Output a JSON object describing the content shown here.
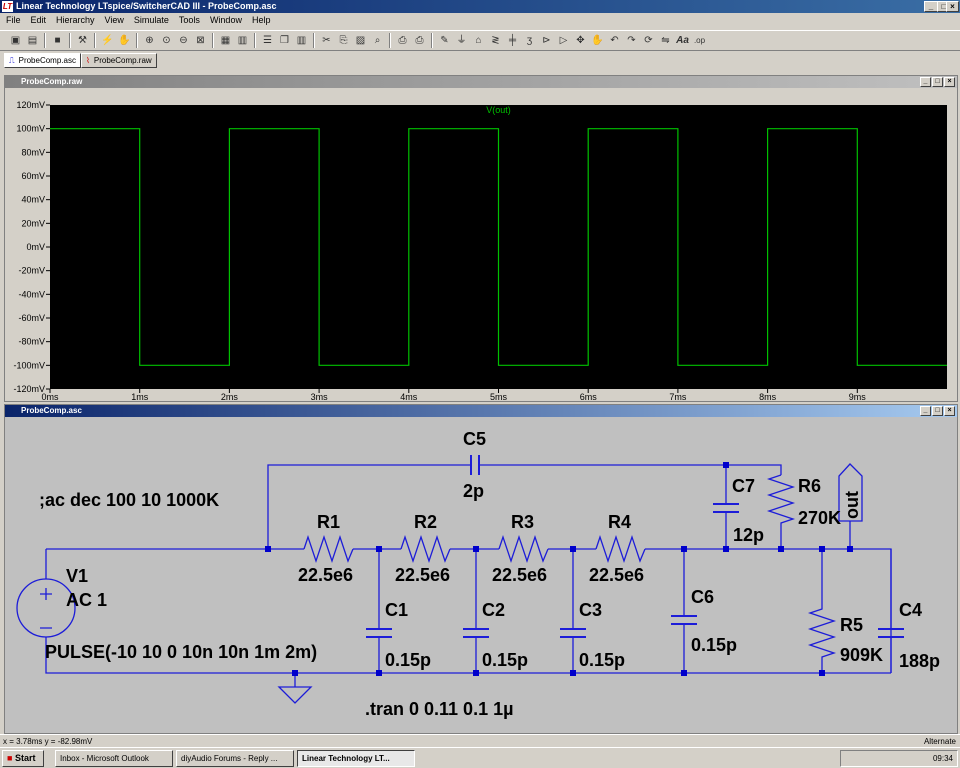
{
  "app": {
    "title": "Linear Technology LTspice/SwitcherCAD III - ProbeComp.asc",
    "window_buttons": [
      "_",
      "□",
      "×"
    ]
  },
  "menu": [
    "File",
    "Edit",
    "Hierarchy",
    "View",
    "Simulate",
    "Tools",
    "Window",
    "Help"
  ],
  "toolbar": {
    "icons": [
      "new-schematic-icon",
      "open-icon",
      "save-icon",
      "control-panel-icon",
      "run-icon",
      "halt-icon",
      "zoom-in-icon",
      "pan-icon",
      "zoom-out-icon",
      "zoom-fit-icon",
      "autorange-icon",
      "fft-icon",
      "tile-horizontal-icon",
      "cascade-icon",
      "tile-vertical-icon",
      "cut-icon",
      "copy-icon",
      "paste-icon",
      "find-icon",
      "print-setup-icon",
      "print-icon",
      "wire-icon",
      "ground-icon",
      "label-net-icon",
      "resistor-icon",
      "capacitor-icon",
      "inductor-icon",
      "diode-icon",
      "component-icon",
      "move-icon",
      "drag-icon",
      "undo-icon",
      "redo-icon",
      "rotate-icon",
      "mirror-icon",
      "text-icon",
      "spice-directive-icon"
    ]
  },
  "tabs": [
    {
      "label": "ProbeComp.asc"
    },
    {
      "label": "ProbeComp.raw"
    }
  ],
  "waveform_window": {
    "title": "ProbeComp.raw",
    "trace_label": "V(out)",
    "trace_color": "#00c000",
    "bg": "#000000"
  },
  "chart_data": {
    "type": "line",
    "title": "V(out)",
    "xlabel": "",
    "ylabel": "",
    "xlim": [
      0,
      10
    ],
    "ylim": [
      -120,
      120
    ],
    "x_ticks": [
      "0ms",
      "1ms",
      "2ms",
      "3ms",
      "4ms",
      "5ms",
      "6ms",
      "7ms",
      "8ms",
      "9ms"
    ],
    "y_ticks": [
      "120mV",
      "100mV",
      "80mV",
      "60mV",
      "40mV",
      "20mV",
      "0mV",
      "-20mV",
      "-40mV",
      "-60mV",
      "-80mV",
      "-100mV",
      "-120mV"
    ],
    "series": [
      {
        "name": "V(out)",
        "x": [
          0,
          1,
          1,
          2,
          2,
          3,
          3,
          4,
          4,
          5,
          5,
          6,
          6,
          7,
          7,
          8,
          8,
          9,
          9,
          10
        ],
        "y": [
          100,
          100,
          -100,
          -100,
          100,
          100,
          -100,
          -100,
          100,
          100,
          -100,
          -100,
          100,
          100,
          -100,
          -100,
          100,
          100,
          -100,
          -100
        ]
      }
    ]
  },
  "schematic_window": {
    "title": "ProbeComp.asc",
    "labels": {
      "c5": "C5",
      "c5v": "2p",
      "ac": ";ac dec 100 10 1000K",
      "r1": "R1",
      "r1v": "22.5e6",
      "r2": "R2",
      "r2v": "22.5e6",
      "r3": "R3",
      "r3v": "22.5e6",
      "r4": "R4",
      "r4v": "22.5e6",
      "c7": "C7",
      "c7v": "12p",
      "r6": "R6",
      "r6v": "270K",
      "out": "out",
      "v1": "V1",
      "v1v": "AC 1",
      "pulse": "PULSE(-10 10 0 10n 10n 1m 2m)",
      "c1": "C1",
      "c1v": "0.15p",
      "c2": "C2",
      "c2v": "0.15p",
      "c3": "C3",
      "c3v": "0.15p",
      "c6": "C6",
      "c6v": "0.15p",
      "r5": "R5",
      "r5v": "909K",
      "c4": "C4",
      "c4v": "188p",
      "tran": ".tran 0 0.11 0.1 1µ"
    }
  },
  "status": {
    "coords": "x = 3.78ms   y = -82.98mV",
    "mode": "Alternate"
  },
  "taskbar": {
    "start": "Start",
    "tasks": [
      "Inbox - Microsoft Outlook",
      "diyAudio Forums - Reply ...",
      "Linear Technology LT..."
    ],
    "clock": "09:34"
  }
}
